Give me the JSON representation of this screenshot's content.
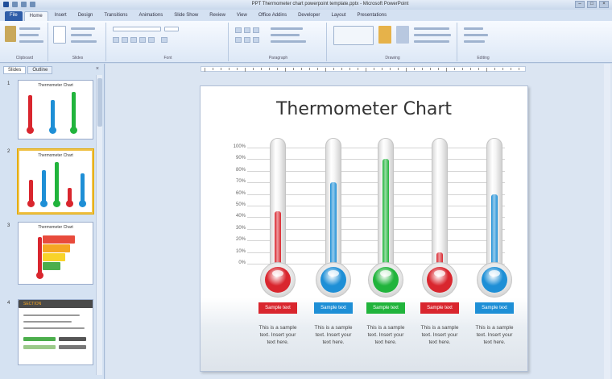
{
  "app": {
    "window_title": "PPT Thermometer chart powerpoint template.pptx - Microsoft PowerPoint",
    "window_controls": [
      "–",
      "□",
      "×"
    ]
  },
  "ribbon": {
    "tabs": [
      "File",
      "Home",
      "Insert",
      "Design",
      "Transitions",
      "Animations",
      "Slide Show",
      "Review",
      "View",
      "Office Addins",
      "Developer",
      "Layout",
      "Presentations"
    ],
    "active_tab": "Home",
    "groups": [
      "Clipboard",
      "Slides",
      "Font",
      "Paragraph",
      "Drawing",
      "Editing"
    ]
  },
  "left_panel": {
    "tabs": [
      "Slides",
      "Outline"
    ],
    "close": "×",
    "thumbnails": [
      {
        "number": "1",
        "title": "Thermometer Chart"
      },
      {
        "number": "2",
        "title": "Thermometer Chart"
      },
      {
        "number": "3",
        "title": "Thermometer Chart"
      },
      {
        "number": "4",
        "title": "SECTION"
      }
    ]
  },
  "slide": {
    "title": "Thermometer Chart"
  },
  "chart_data": {
    "type": "bar",
    "title": "Thermometer Chart",
    "categories": [
      "Sample text",
      "Sample text",
      "Sample text",
      "Sample text",
      "Sample text"
    ],
    "values": [
      45,
      70,
      90,
      10,
      60
    ],
    "ylim": [
      0,
      100
    ],
    "y_ticks": [
      "0%",
      "10%",
      "20%",
      "30%",
      "40%",
      "50%",
      "60%",
      "70%",
      "80%",
      "90%",
      "100%"
    ],
    "grid": true,
    "colors": [
      "#d9262e",
      "#1e8fd6",
      "#21b43c",
      "#d9262e",
      "#1e8fd6"
    ]
  },
  "labels": {
    "badges": [
      "Sample text",
      "Sample text",
      "Sample text",
      "Sample text",
      "Sample text"
    ],
    "descriptions": [
      "This is a sample text. Insert your text here.",
      "This is a sample text. Insert your text here.",
      "This is a sample text. Insert your text here.",
      "This is a sample text. Insert your text here.",
      "This is a sample text. Insert your text here."
    ]
  }
}
